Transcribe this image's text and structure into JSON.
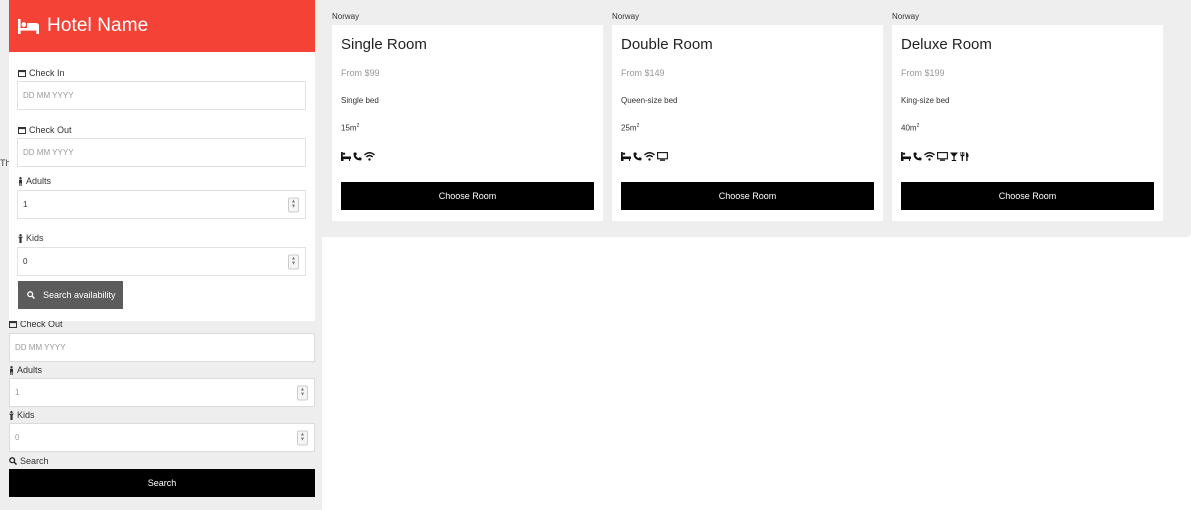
{
  "hotel": {
    "name": "Hotel Name"
  },
  "overlay_form": {
    "check_in_label": "Check In",
    "check_in_placeholder": "DD MM YYYY",
    "check_out_label": "Check Out",
    "check_out_placeholder": "DD MM YYYY",
    "adults_label": "Adults",
    "adults_value": "1",
    "kids_label": "Kids",
    "kids_value": "0",
    "search_button": "Search availability"
  },
  "background_form": {
    "cut_text": "Th",
    "check_out_label": "Check Out",
    "check_out_placeholder": "DD MM YYYY",
    "adults_label": "Adults",
    "adults_value": "1",
    "kids_label": "Kids",
    "kids_value": "0",
    "search_label": "Search",
    "search_button": "Search"
  },
  "rooms": [
    {
      "country": "Norway",
      "title": "Single Room",
      "price": "From $99",
      "bed": "Single bed",
      "size": "15m",
      "size_unit_sup": "2",
      "amenities": [
        "bath-icon",
        "phone-icon",
        "wifi-icon"
      ],
      "button": "Choose Room"
    },
    {
      "country": "Norway",
      "title": "Double Room",
      "price": "From $149",
      "bed": "Queen-size bed",
      "size": "25m",
      "size_unit_sup": "2",
      "amenities": [
        "bath-icon",
        "phone-icon",
        "wifi-icon",
        "tv-icon"
      ],
      "button": "Choose Room"
    },
    {
      "country": "Norway",
      "title": "Deluxe Room",
      "price": "From $199",
      "bed": "King-size bed",
      "size": "40m",
      "size_unit_sup": "2",
      "amenities": [
        "bath-icon",
        "phone-icon",
        "wifi-icon",
        "tv-icon",
        "cocktail-icon",
        "cutlery-icon"
      ],
      "button": "Choose Room"
    }
  ],
  "colors": {
    "header_red": "#f44336",
    "button_black": "#000000",
    "button_grey": "#5c5c5c",
    "page_grey": "#eeeeee"
  }
}
